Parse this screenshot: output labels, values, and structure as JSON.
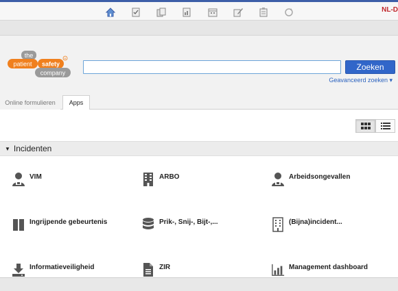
{
  "toolbar": {
    "icons": [
      "home-icon",
      "checklist-icon",
      "documents-icon",
      "report-icon",
      "calendar-icon",
      "edit-icon",
      "clipboard-icon",
      "refresh-icon"
    ],
    "language": "NL-D"
  },
  "brand": {
    "logo_the": "the",
    "logo_patient": "patient",
    "logo_safety": "safety",
    "logo_company": "company",
    "accent": "#f0801e",
    "gray": "#9a9a9a"
  },
  "search": {
    "value": "",
    "button": "Zoeken",
    "advanced": "Geavanceerd zoeken ▾"
  },
  "tabs": [
    {
      "label": "Online formulieren",
      "active": false
    },
    {
      "label": "Apps",
      "active": true
    }
  ],
  "section": {
    "title": "Incidenten"
  },
  "apps": [
    {
      "label": "VIM",
      "icon": "person-icon"
    },
    {
      "label": "ARBO",
      "icon": "building-icon"
    },
    {
      "label": "Arbeidsongevallen",
      "icon": "person-icon"
    },
    {
      "label": "Ingrijpende gebeurtenis",
      "icon": "pause-icon"
    },
    {
      "label": "Prik-, Snij-, Bijt-,...",
      "icon": "database-icon"
    },
    {
      "label": "(Bijna)incident...",
      "icon": "building-icon"
    },
    {
      "label": "Informatieveiligheid",
      "icon": "download-icon"
    },
    {
      "label": "ZIR",
      "icon": "document-icon"
    },
    {
      "label": "Management dashboard",
      "icon": "bar-chart-icon"
    }
  ]
}
